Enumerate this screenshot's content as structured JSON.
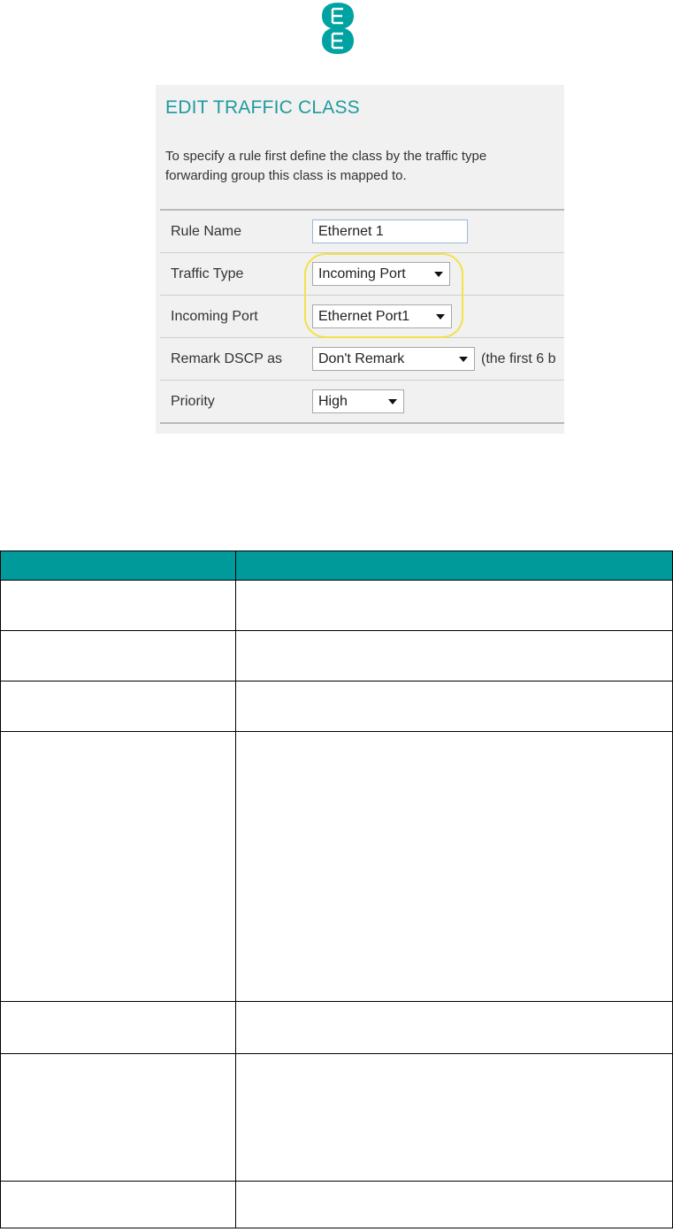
{
  "shot": {
    "title": "EDIT TRAFFIC CLASS",
    "description_line1": "To specify a rule first define the class by the traffic type",
    "description_line2": "forwarding group this class is mapped to.",
    "rows": {
      "rule_name": {
        "label": "Rule Name",
        "value": "Ethernet 1"
      },
      "traffic_type": {
        "label": "Traffic Type",
        "value": "Incoming Port"
      },
      "incoming_port": {
        "label": "Incoming Port",
        "value": "Ethernet Port1"
      },
      "remark_dscp": {
        "label": "Remark DSCP as",
        "value": "Don't Remark",
        "hint": "(the first 6 b"
      },
      "priority": {
        "label": "Priority",
        "value": "High"
      }
    }
  },
  "colors": {
    "brand": "#00a3a1",
    "title": "#1f9b9e",
    "table_header": "#009a9a",
    "highlight": "#f2e24a"
  },
  "icons": {
    "logo": "ee-logo"
  }
}
